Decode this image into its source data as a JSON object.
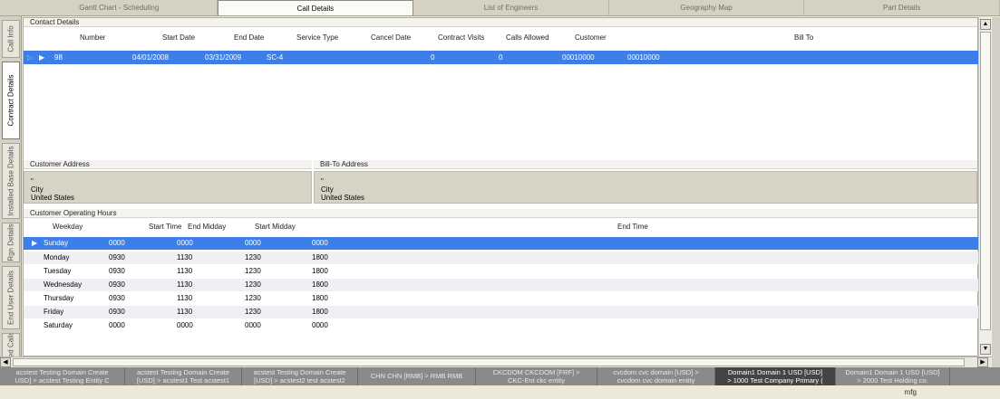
{
  "top_tabs": [
    {
      "label": "Gantt Chart - Scheduling"
    },
    {
      "label": "Call Details"
    },
    {
      "label": "List of Engineers"
    },
    {
      "label": "Geography Map"
    },
    {
      "label": "Part Details"
    }
  ],
  "active_top_tab": "Call Details",
  "left_tabs": [
    {
      "label": "Call Info"
    },
    {
      "label": "Contract Details"
    },
    {
      "label": "Installed Base Details"
    },
    {
      "label": "Rgn Details"
    },
    {
      "label": "End User Details"
    },
    {
      "label": "Ited Calls"
    }
  ],
  "contact_details": {
    "title": "Contact Details",
    "columns": [
      "Number",
      "Start Date",
      "End Date",
      "Service Type",
      "Cancel Date",
      "Contract Visits",
      "Calls Allowed",
      "Customer",
      "Bill To"
    ],
    "rows": [
      {
        "number": "98",
        "start_date": "04/01/2008",
        "end_date": "03/31/2009",
        "service_type": "SC-4",
        "cancel_date": "",
        "contract_visits": "0",
        "calls_allowed": "0",
        "customer": "00010000",
        "bill_to": "00010000"
      }
    ]
  },
  "customer_address": {
    "title": "Customer Address",
    "line1": "\"",
    "city": "City",
    "country": "United States"
  },
  "bill_to_address": {
    "title": "Bill-To Address",
    "line1": "\"",
    "city": "City",
    "country": "United States"
  },
  "operating_hours": {
    "title": "Customer Operating Hours",
    "columns": [
      "Weekday",
      "Start Time",
      "End Midday",
      "Start Midday",
      "End Time"
    ],
    "rows": [
      {
        "weekday": "Sunday",
        "start_time": "0000",
        "end_midday": "0000",
        "start_midday": "0000",
        "end_time": "0000"
      },
      {
        "weekday": "Monday",
        "start_time": "0930",
        "end_midday": "1130",
        "start_midday": "1230",
        "end_time": "1800"
      },
      {
        "weekday": "Tuesday",
        "start_time": "0930",
        "end_midday": "1130",
        "start_midday": "1230",
        "end_time": "1800"
      },
      {
        "weekday": "Wednesday",
        "start_time": "0930",
        "end_midday": "1130",
        "start_midday": "1230",
        "end_time": "1800"
      },
      {
        "weekday": "Thursday",
        "start_time": "0930",
        "end_midday": "1130",
        "start_midday": "1230",
        "end_time": "1800"
      },
      {
        "weekday": "Friday",
        "start_time": "0930",
        "end_midday": "1130",
        "start_midday": "1230",
        "end_time": "1800"
      },
      {
        "weekday": "Saturday",
        "start_time": "0000",
        "end_midday": "0000",
        "start_midday": "0000",
        "end_time": "0000"
      }
    ]
  },
  "domains": [
    {
      "line1": "acstest Testing Domain Create",
      "line2": "USD] > acstest Testing Entity C"
    },
    {
      "line1": "acstest Testing Domain Create",
      "line2": "[USD] > acstest1 Test acstest1"
    },
    {
      "line1": "acstest Testing Domain Create",
      "line2": "[USD] > acstest2 test acstest2"
    },
    {
      "line1": "CHN CHN [RMB] > RMB RMB",
      "line2": ""
    },
    {
      "line1": "CKCDOM CKCDOM [FRF] >",
      "line2": "CKC-Ent ckc entity"
    },
    {
      "line1": "cvcdom cvc domain [USD] >",
      "line2": "cvcdom cvc domain entity"
    },
    {
      "line1": "Domain1 Domain 1 USD [USD]",
      "line2": "> 1000 Test Company Primary ("
    },
    {
      "line1": "Domain1 Domain 1 USD [USD]",
      "line2": "> 2000 Test Holding co."
    }
  ],
  "status": {
    "user": "mfg"
  },
  "colors": {
    "selection": "#3d7fe6",
    "window": "#ece9d8"
  }
}
